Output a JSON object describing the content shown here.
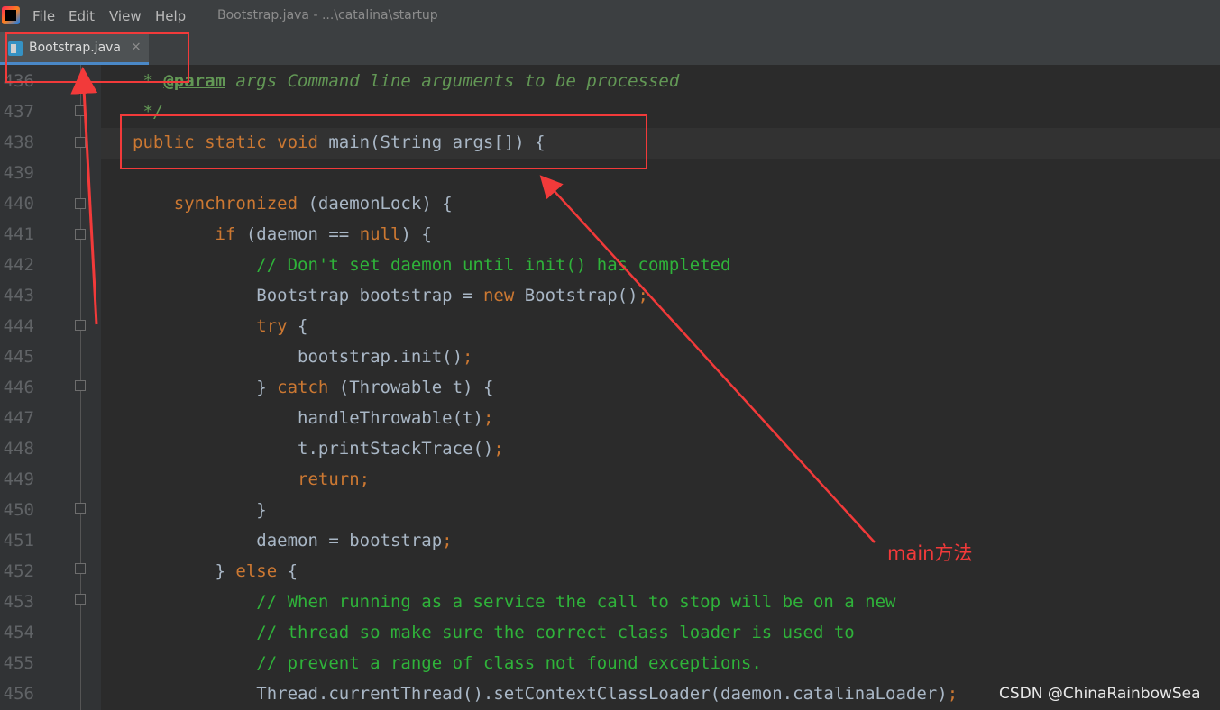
{
  "menubar": {
    "menus": [
      {
        "label": "File"
      },
      {
        "label": "Edit"
      },
      {
        "label": "View"
      },
      {
        "label": "Help"
      }
    ],
    "title": "Bootstrap.java - ...\\catalina\\startup"
  },
  "tabs": [
    {
      "label": "Bootstrap.java",
      "close": "×"
    }
  ],
  "editor": {
    "line_numbers": [
      "436",
      "437",
      "438",
      "439",
      "440",
      "441",
      "442",
      "443",
      "444",
      "445",
      "446",
      "447",
      "448",
      "449",
      "450",
      "451",
      "452",
      "453",
      "454",
      "455",
      "456"
    ],
    "current_line": "438",
    "lines": [
      {
        "num": "436",
        "t": [
          {
            "c": "cm",
            "s": " * "
          },
          {
            "c": "tag",
            "s": "@param"
          },
          {
            "c": "cm",
            "s": " args Command line arguments to be processed"
          }
        ]
      },
      {
        "num": "437",
        "t": [
          {
            "c": "cm",
            "s": " */"
          }
        ]
      },
      {
        "num": "438",
        "t": [
          {
            "c": "kw",
            "s": "public static void "
          },
          {
            "c": "",
            "s": "main(String args[]) {"
          }
        ]
      },
      {
        "num": "439",
        "t": []
      },
      {
        "num": "440",
        "t": [
          {
            "c": "",
            "s": "    "
          },
          {
            "c": "kw",
            "s": "synchronized"
          },
          {
            "c": "",
            "s": " (daemonLock) {"
          }
        ]
      },
      {
        "num": "441",
        "t": [
          {
            "c": "",
            "s": "        "
          },
          {
            "c": "kw",
            "s": "if"
          },
          {
            "c": "",
            "s": " (daemon == "
          },
          {
            "c": "kw",
            "s": "null"
          },
          {
            "c": "",
            "s": ") {"
          }
        ]
      },
      {
        "num": "442",
        "t": [
          {
            "c": "",
            "s": "            "
          },
          {
            "c": "lc",
            "s": "// Don't set daemon until init() has completed"
          }
        ]
      },
      {
        "num": "443",
        "t": [
          {
            "c": "",
            "s": "            Bootstrap bootstrap = "
          },
          {
            "c": "kw",
            "s": "new"
          },
          {
            "c": "",
            "s": " Bootstrap()"
          },
          {
            "c": "kw",
            "s": ";"
          }
        ]
      },
      {
        "num": "444",
        "t": [
          {
            "c": "",
            "s": "            "
          },
          {
            "c": "kw",
            "s": "try"
          },
          {
            "c": "",
            "s": " {"
          }
        ]
      },
      {
        "num": "445",
        "t": [
          {
            "c": "",
            "s": "                bootstrap.init()"
          },
          {
            "c": "kw",
            "s": ";"
          }
        ]
      },
      {
        "num": "446",
        "t": [
          {
            "c": "",
            "s": "            } "
          },
          {
            "c": "kw",
            "s": "catch"
          },
          {
            "c": "",
            "s": " (Throwable t) {"
          }
        ]
      },
      {
        "num": "447",
        "t": [
          {
            "c": "",
            "s": "                handleThrowable(t)"
          },
          {
            "c": "kw",
            "s": ";"
          }
        ]
      },
      {
        "num": "448",
        "t": [
          {
            "c": "",
            "s": "                t.printStackTrace()"
          },
          {
            "c": "kw",
            "s": ";"
          }
        ]
      },
      {
        "num": "449",
        "t": [
          {
            "c": "",
            "s": "                "
          },
          {
            "c": "kw",
            "s": "return;"
          }
        ]
      },
      {
        "num": "450",
        "t": [
          {
            "c": "",
            "s": "            }"
          }
        ]
      },
      {
        "num": "451",
        "t": [
          {
            "c": "",
            "s": "            daemon = bootstrap"
          },
          {
            "c": "kw",
            "s": ";"
          }
        ]
      },
      {
        "num": "452",
        "t": [
          {
            "c": "",
            "s": "        } "
          },
          {
            "c": "kw",
            "s": "else"
          },
          {
            "c": "",
            "s": " {"
          }
        ]
      },
      {
        "num": "453",
        "t": [
          {
            "c": "",
            "s": "            "
          },
          {
            "c": "lc",
            "s": "// When running as a service the call to stop will be on a new"
          }
        ]
      },
      {
        "num": "454",
        "t": [
          {
            "c": "",
            "s": "            "
          },
          {
            "c": "lc",
            "s": "// thread so make sure the correct class loader is used to"
          }
        ]
      },
      {
        "num": "455",
        "t": [
          {
            "c": "",
            "s": "            "
          },
          {
            "c": "lc",
            "s": "// prevent a range of class not found exceptions."
          }
        ]
      },
      {
        "num": "456",
        "t": [
          {
            "c": "",
            "s": "            Thread.currentThread().setContextClassLoader(daemon.catalinaLoader)"
          },
          {
            "c": "kw",
            "s": ";"
          }
        ]
      }
    ]
  },
  "annotation": {
    "label": "main方法",
    "color": "#f23a3a"
  },
  "watermark": "CSDN @ChinaRainbowSea",
  "colors": {
    "keyword": "#cc7832",
    "comment": "#629755",
    "line_comment": "#2fb33a",
    "text": "#a9b7c6",
    "background": "#2b2b2b"
  }
}
